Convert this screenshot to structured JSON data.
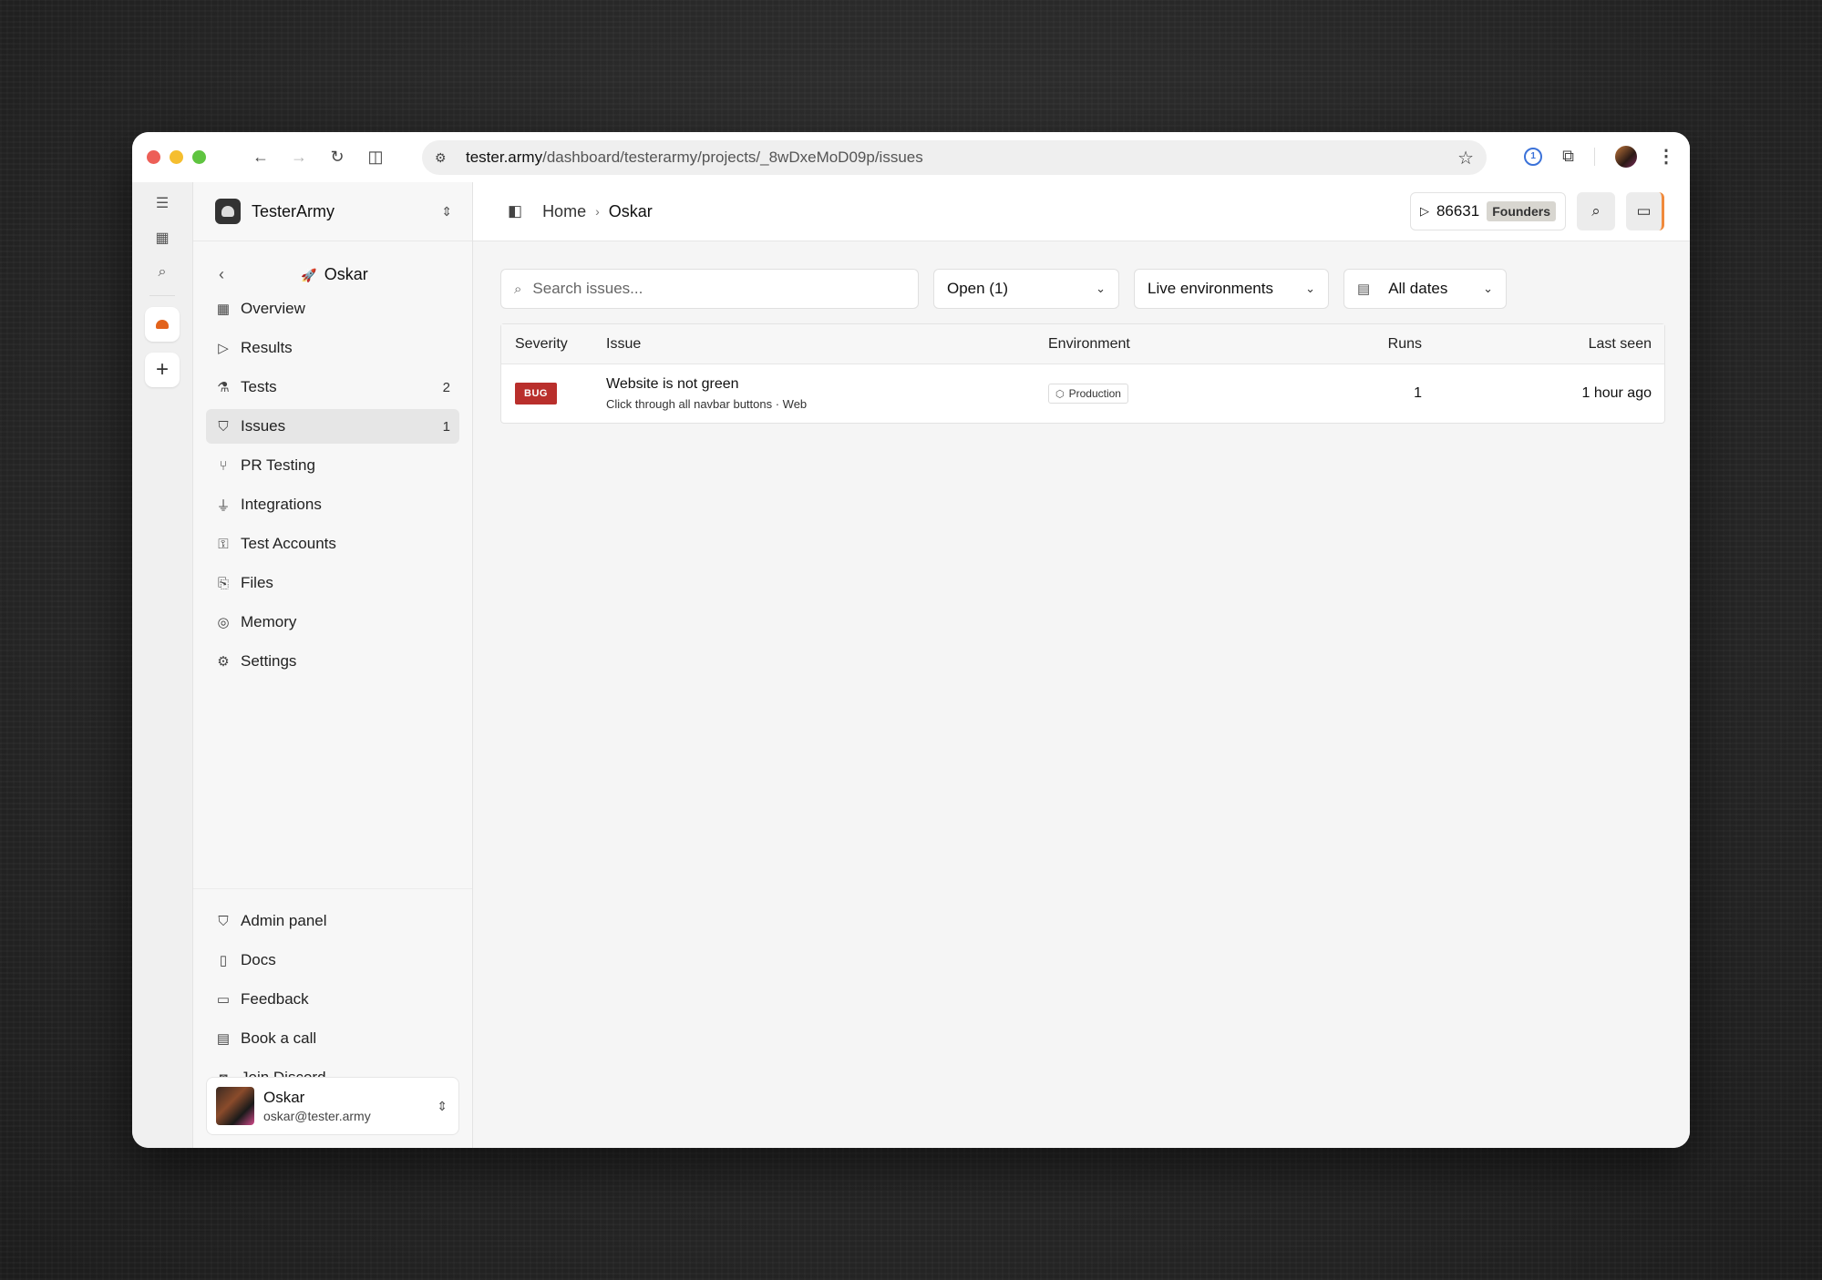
{
  "browser": {
    "url_host": "tester.army",
    "url_path": "/dashboard/testerarmy/projects/_8wDxeMoD09p/issues"
  },
  "org": {
    "name": "TesterArmy"
  },
  "project": {
    "name": "Oskar"
  },
  "sidebar": {
    "items": [
      {
        "label": "Overview",
        "count": ""
      },
      {
        "label": "Results",
        "count": ""
      },
      {
        "label": "Tests",
        "count": "2"
      },
      {
        "label": "Issues",
        "count": "1"
      },
      {
        "label": "PR Testing",
        "count": ""
      },
      {
        "label": "Integrations",
        "count": ""
      },
      {
        "label": "Test Accounts",
        "count": ""
      },
      {
        "label": "Files",
        "count": ""
      },
      {
        "label": "Memory",
        "count": ""
      },
      {
        "label": "Settings",
        "count": ""
      }
    ],
    "bottom_items": [
      {
        "label": "Admin panel"
      },
      {
        "label": "Docs"
      },
      {
        "label": "Feedback"
      },
      {
        "label": "Book a call"
      },
      {
        "label": "Join Discord"
      }
    ]
  },
  "user": {
    "name": "Oskar",
    "email": "oskar@tester.army"
  },
  "breadcrumb": {
    "home": "Home",
    "current": "Oskar"
  },
  "topbar": {
    "runs": "86631",
    "plan": "Founders"
  },
  "filters": {
    "search_placeholder": "Search issues...",
    "status": "Open (1)",
    "environment": "Live environments",
    "dates": "All dates"
  },
  "table": {
    "columns": [
      "Severity",
      "Issue",
      "Environment",
      "Runs",
      "Last seen"
    ],
    "rows": [
      {
        "severity": "BUG",
        "title": "Website is not green",
        "subtitle": "Click through all navbar buttons · Web",
        "environment": "Production",
        "runs": "1",
        "last_seen": "1 hour ago"
      }
    ]
  },
  "colors": {
    "bug": "#b92f2c",
    "accent": "#e2621b",
    "founders_badge": "#d8d6d0"
  }
}
